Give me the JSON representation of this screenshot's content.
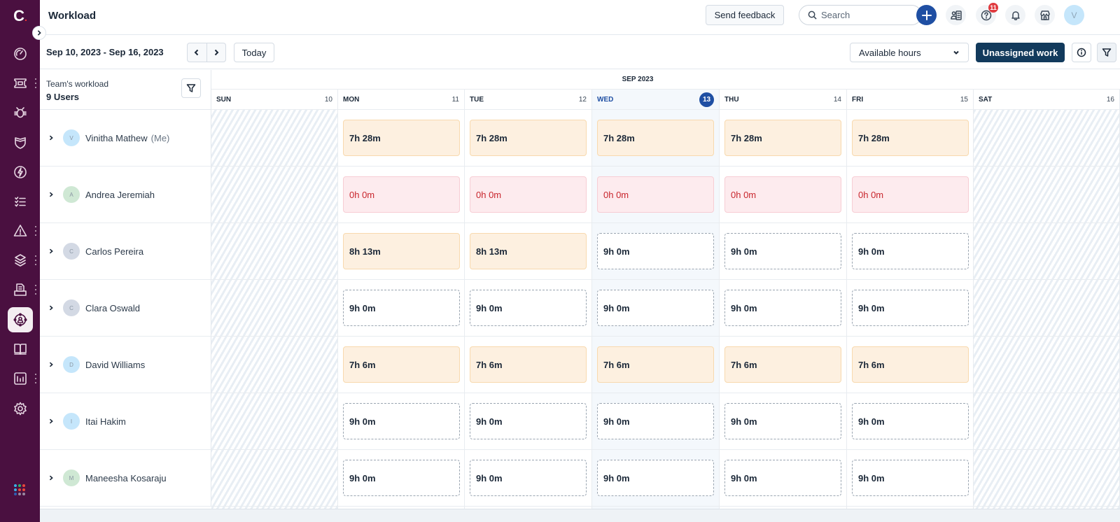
{
  "app": {
    "logo": "C",
    "page_title": "Workload"
  },
  "sidebar": {
    "items": [
      {
        "name": "dashboard",
        "icon": "gauge-icon",
        "has_more": false
      },
      {
        "name": "tickets",
        "icon": "ticket-icon",
        "has_more": true
      },
      {
        "name": "problems",
        "icon": "bug-icon",
        "has_more": false
      },
      {
        "name": "changes",
        "icon": "shield-icon",
        "has_more": false
      },
      {
        "name": "releases",
        "icon": "lightning-icon",
        "has_more": false
      },
      {
        "name": "tasks",
        "icon": "checklist-icon",
        "has_more": false
      },
      {
        "name": "alerts",
        "icon": "warning-icon",
        "has_more": true
      },
      {
        "name": "assets",
        "icon": "layers-icon",
        "has_more": true
      },
      {
        "name": "contracts",
        "icon": "document-icon",
        "has_more": true
      },
      {
        "name": "workload",
        "icon": "team-workload-icon",
        "has_more": false,
        "active": true
      },
      {
        "name": "solutions",
        "icon": "book-icon",
        "has_more": false
      },
      {
        "name": "analytics",
        "icon": "bar-chart-icon",
        "has_more": true
      },
      {
        "name": "admin",
        "icon": "gear-icon",
        "has_more": false
      }
    ],
    "apps_icon": "apps-grid-icon"
  },
  "topbar": {
    "feedback_label": "Send feedback",
    "search_placeholder": "Search",
    "help_badge": "11",
    "avatar_initial": "V"
  },
  "toolbar": {
    "date_range": "Sep 10, 2023 - Sep 16, 2023",
    "today_label": "Today",
    "view_select": "Available hours",
    "unassigned_label": "Unassigned work"
  },
  "team": {
    "label": "Team's workload",
    "count": "9 Users"
  },
  "calendar": {
    "month": "SEP 2023",
    "days": [
      {
        "name": "SUN",
        "num": "10",
        "weekend": true
      },
      {
        "name": "MON",
        "num": "11"
      },
      {
        "name": "TUE",
        "num": "12"
      },
      {
        "name": "WED",
        "num": "13",
        "today": true
      },
      {
        "name": "THU",
        "num": "14"
      },
      {
        "name": "FRI",
        "num": "15"
      },
      {
        "name": "SAT",
        "num": "16",
        "weekend": true
      }
    ]
  },
  "users": [
    {
      "name": "Vinitha Mathew",
      "suffix": "(Me)",
      "initial": "V",
      "avatar_color": "#c5e6fb",
      "hours": [
        {
          "value": "7h 28m",
          "status": "partial"
        },
        {
          "value": "7h 28m",
          "status": "partial"
        },
        {
          "value": "7h 28m",
          "status": "partial"
        },
        {
          "value": "7h 28m",
          "status": "partial"
        },
        {
          "value": "7h 28m",
          "status": "partial"
        }
      ]
    },
    {
      "name": "Andrea Jeremiah",
      "suffix": "",
      "initial": "A",
      "avatar_color": "#cfe8d4",
      "hours": [
        {
          "value": "0h 0m",
          "status": "zero"
        },
        {
          "value": "0h 0m",
          "status": "zero"
        },
        {
          "value": "0h 0m",
          "status": "zero"
        },
        {
          "value": "0h 0m",
          "status": "zero"
        },
        {
          "value": "0h 0m",
          "status": "zero"
        }
      ]
    },
    {
      "name": "Carlos Pereira",
      "suffix": "",
      "initial": "C",
      "avatar_color": "#d3d9e4",
      "hours": [
        {
          "value": "8h 13m",
          "status": "partial"
        },
        {
          "value": "8h 13m",
          "status": "partial"
        },
        {
          "value": "9h 0m",
          "status": "free"
        },
        {
          "value": "9h 0m",
          "status": "free"
        },
        {
          "value": "9h 0m",
          "status": "free"
        }
      ]
    },
    {
      "name": "Clara Oswald",
      "suffix": "",
      "initial": "C",
      "avatar_color": "#d3d9e4",
      "hours": [
        {
          "value": "9h 0m",
          "status": "free"
        },
        {
          "value": "9h 0m",
          "status": "free"
        },
        {
          "value": "9h 0m",
          "status": "free"
        },
        {
          "value": "9h 0m",
          "status": "free"
        },
        {
          "value": "9h 0m",
          "status": "free"
        }
      ]
    },
    {
      "name": "David Williams",
      "suffix": "",
      "initial": "D",
      "avatar_color": "#c5e6fb",
      "hours": [
        {
          "value": "7h 6m",
          "status": "partial"
        },
        {
          "value": "7h 6m",
          "status": "partial"
        },
        {
          "value": "7h 6m",
          "status": "partial"
        },
        {
          "value": "7h 6m",
          "status": "partial"
        },
        {
          "value": "7h 6m",
          "status": "partial"
        }
      ]
    },
    {
      "name": "Itai Hakim",
      "suffix": "",
      "initial": "I",
      "avatar_color": "#c5e6fb",
      "hours": [
        {
          "value": "9h 0m",
          "status": "free"
        },
        {
          "value": "9h 0m",
          "status": "free"
        },
        {
          "value": "9h 0m",
          "status": "free"
        },
        {
          "value": "9h 0m",
          "status": "free"
        },
        {
          "value": "9h 0m",
          "status": "free"
        }
      ]
    },
    {
      "name": "Maneesha Kosaraju",
      "suffix": "",
      "initial": "M",
      "avatar_color": "#cfe8d4",
      "hours": [
        {
          "value": "9h 0m",
          "status": "free"
        },
        {
          "value": "9h 0m",
          "status": "free"
        },
        {
          "value": "9h 0m",
          "status": "free"
        },
        {
          "value": "9h 0m",
          "status": "free"
        },
        {
          "value": "9h 0m",
          "status": "free"
        }
      ]
    }
  ],
  "colors": {
    "sidebar_bg": "#4a1040",
    "accent_blue": "#1f4fa3",
    "primary_button": "#123a5c",
    "partial_bg": "#fdf0e0",
    "zero_bg": "#fdebee",
    "zero_text": "#c8252c",
    "badge_red": "#e0393e"
  }
}
